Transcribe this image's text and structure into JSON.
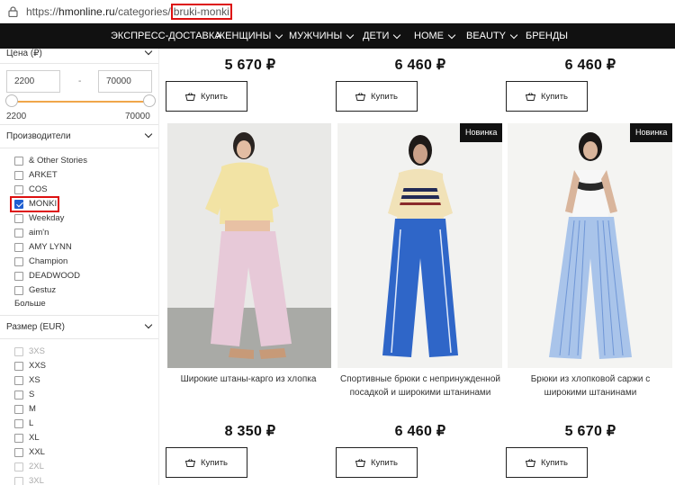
{
  "browser": {
    "url_scheme": "https://",
    "url_host": "hmonline.ru",
    "url_path": "/categories/",
    "url_highlight": "bruki-monki"
  },
  "nav": {
    "items": [
      {
        "label": "ЭКСПРЕСС-ДОСТАВКА"
      },
      {
        "label": "ЖЕНЩИНЫ"
      },
      {
        "label": "МУЖЧИНЫ"
      },
      {
        "label": "ДЕТИ"
      },
      {
        "label": "HOME"
      },
      {
        "label": "BEAUTY"
      },
      {
        "label": "БРЕНДЫ"
      }
    ]
  },
  "filters": {
    "price": {
      "title": "Цена (₽)",
      "min_value": "2200",
      "max_value": "70000",
      "dash": "-",
      "range_min_label": "2200",
      "range_max_label": "70000"
    },
    "brands": {
      "title": "Производители",
      "items": [
        {
          "label": "& Other Stories",
          "checked": false
        },
        {
          "label": "ARKET",
          "checked": false
        },
        {
          "label": "COS",
          "checked": false
        },
        {
          "label": "MONKI",
          "checked": true
        },
        {
          "label": "Weekday",
          "checked": false
        },
        {
          "label": "aim'n",
          "checked": false
        },
        {
          "label": "AMY LYNN",
          "checked": false
        },
        {
          "label": "Champion",
          "checked": false
        },
        {
          "label": "DEADWOOD",
          "checked": false
        },
        {
          "label": "Gestuz",
          "checked": false
        }
      ],
      "more_label": "Больше"
    },
    "sizes": {
      "title": "Размер (EUR)",
      "items": [
        {
          "label": "3XS",
          "enabled": false
        },
        {
          "label": "XXS",
          "enabled": true
        },
        {
          "label": "XS",
          "enabled": true
        },
        {
          "label": "S",
          "enabled": true
        },
        {
          "label": "M",
          "enabled": true
        },
        {
          "label": "L",
          "enabled": true
        },
        {
          "label": "XL",
          "enabled": true
        },
        {
          "label": "XXL",
          "enabled": true
        },
        {
          "label": "2XL",
          "enabled": false
        },
        {
          "label": "3XL",
          "enabled": false
        }
      ]
    }
  },
  "top_row": [
    {
      "price": "5 670 ₽",
      "buy_label": "Купить"
    },
    {
      "price": "6 460 ₽",
      "buy_label": "Купить"
    },
    {
      "price": "6 460 ₽",
      "buy_label": "Купить"
    }
  ],
  "products": [
    {
      "name": "Широкие штаны-карго из хлопка",
      "price": "8 350 ₽",
      "buy_label": "Купить",
      "badge": ""
    },
    {
      "name": "Спортивные брюки с непринужденной посадкой и широкими штанинами",
      "price": "6 460 ₽",
      "buy_label": "Купить",
      "badge": "Новинка"
    },
    {
      "name": "Брюки из хлопковой саржи с широкими штанинами",
      "price": "5 670 ₽",
      "buy_label": "Купить",
      "badge": "Новинка"
    }
  ],
  "colors": {
    "nav_bg": "#111111",
    "accent_slider": "#f0a64a",
    "highlight_box": "#dd1111",
    "checkbox_checked": "#1f5fd1"
  },
  "icons": [
    "lock-icon",
    "chevron-down-icon",
    "cart-icon"
  ]
}
